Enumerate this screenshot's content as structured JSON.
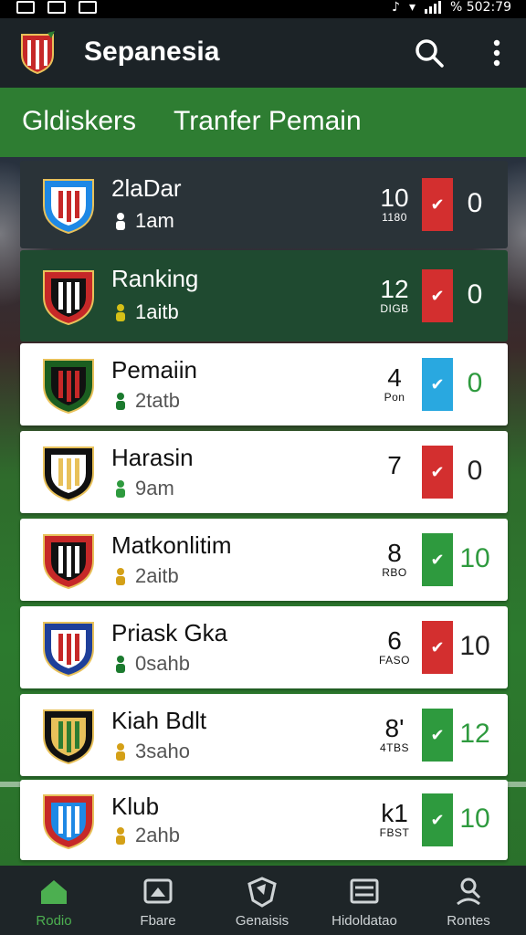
{
  "app": {
    "title": "Sepanesia"
  },
  "status_bar": {
    "text": "%  502:79"
  },
  "tabs": [
    {
      "label": "Gldiskers",
      "active": true
    },
    {
      "label": "Tranfer Pemain",
      "active": false
    }
  ],
  "rows": [
    {
      "name": "2laDar",
      "sub": "1am",
      "sub_icon": "runner-icon",
      "num": "10",
      "num_sub": "1180",
      "badge": "red",
      "score": "0",
      "style": "dark"
    },
    {
      "name": "Ranking",
      "sub": "1aitb",
      "sub_icon": "group-icon",
      "num": "12",
      "num_sub": "DIGB",
      "badge": "red",
      "score": "0",
      "style": "green"
    },
    {
      "name": "Pemaiin",
      "sub": "2tatb",
      "sub_icon": "whistle-icon",
      "num": "4",
      "num_sub": "Pon",
      "badge": "blue",
      "score": "0",
      "style": "light"
    },
    {
      "name": "Harasin",
      "sub": "9am",
      "sub_icon": "group-icon",
      "num": "7",
      "num_sub": "",
      "badge": "red",
      "score": "0",
      "style": "light"
    },
    {
      "name": "Matkonlitim",
      "sub": "2aitb",
      "sub_icon": "medal-icon",
      "num": "8",
      "num_sub": "RBO",
      "badge": "green",
      "score": "10",
      "style": "light"
    },
    {
      "name": "Priask Gka",
      "sub": "0sahb",
      "sub_icon": "whistle-icon",
      "num": "6",
      "num_sub": "FASO",
      "badge": "red",
      "score": "10",
      "style": "light"
    },
    {
      "name": "Kiah Bdlt",
      "sub": "3saho",
      "sub_icon": "medal-icon",
      "num": "8'",
      "num_sub": "4TBS",
      "badge": "green",
      "score": "12",
      "style": "light"
    },
    {
      "name": "Klub",
      "sub": "2ahb",
      "sub_icon": "medal-icon",
      "num": "k1",
      "num_sub": "FBST",
      "badge": "green",
      "score": "10",
      "style": "light"
    }
  ],
  "bottom_nav": [
    {
      "label": "Rodio",
      "icon": "home-icon",
      "active": true
    },
    {
      "label": "Fbare",
      "icon": "image-icon",
      "active": false
    },
    {
      "label": "Genaisis",
      "icon": "shield-icon",
      "active": false
    },
    {
      "label": "Hidoldatao",
      "icon": "list-icon",
      "active": false
    },
    {
      "label": "Rontes",
      "icon": "person-search-icon",
      "active": false
    }
  ],
  "colors": {
    "appbar": "#1c2327",
    "tab_green": "#2e7d32",
    "badge_red": "#d32f2f",
    "badge_green": "#2e9a3e",
    "badge_blue": "#29a8e0",
    "score_green": "#2e9a3e",
    "nav_active": "#4caf50"
  }
}
